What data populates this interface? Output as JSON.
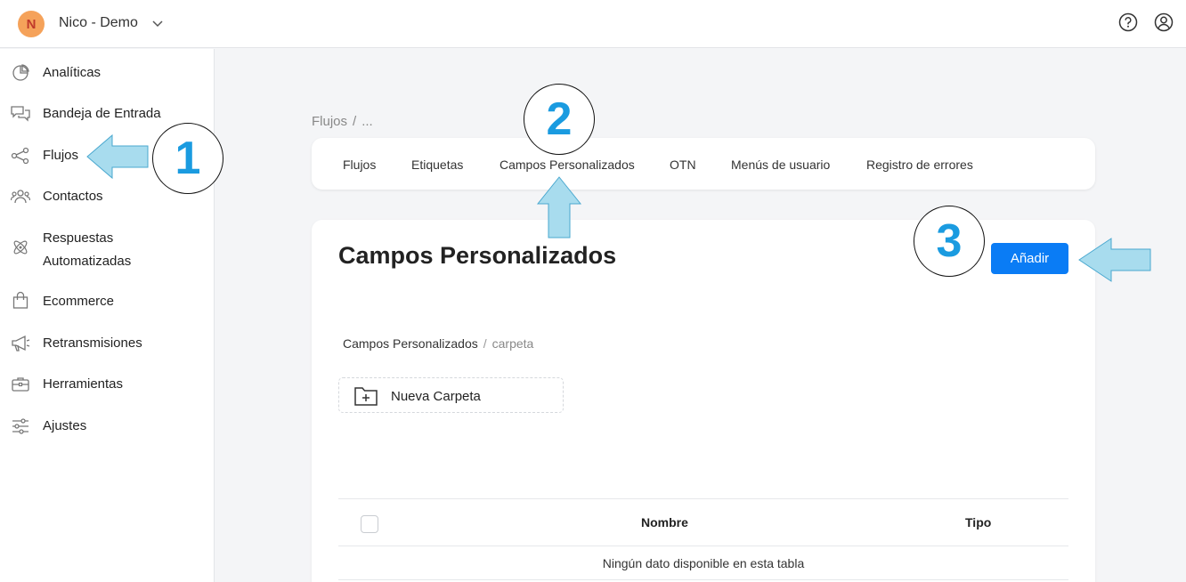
{
  "header": {
    "avatar_initial": "N",
    "workspace": "Nico - Demo"
  },
  "sidebar": {
    "items": [
      {
        "label": "Analíticas",
        "icon": "pie-chart-icon"
      },
      {
        "label": "Bandeja de Entrada",
        "icon": "chat-bubbles-icon"
      },
      {
        "label": "Flujos",
        "icon": "flow-nodes-icon"
      },
      {
        "label": "Contactos",
        "icon": "people-icon"
      },
      {
        "label": "Respuestas",
        "label2": "Automatizadas",
        "icon": "atom-icon"
      },
      {
        "label": "Ecommerce",
        "icon": "shopping-bag-icon"
      },
      {
        "label": "Retransmisiones",
        "icon": "megaphone-icon"
      },
      {
        "label": "Herramientas",
        "icon": "toolbox-icon"
      },
      {
        "label": "Ajustes",
        "icon": "sliders-icon"
      }
    ]
  },
  "breadcrumb": {
    "root": "Flujos",
    "sep": "/",
    "rest": "..."
  },
  "tabs": [
    {
      "label": "Flujos"
    },
    {
      "label": "Etiquetas"
    },
    {
      "label": "Campos Personalizados"
    },
    {
      "label": "OTN"
    },
    {
      "label": "Menús de usuario"
    },
    {
      "label": "Registro de errores"
    }
  ],
  "main": {
    "title": "Campos Personalizados",
    "add_label": "Añadir",
    "inner_crumbs": {
      "root": "Campos Personalizados",
      "sep": "/",
      "current": "carpeta"
    },
    "new_folder_label": "Nueva Carpeta",
    "table": {
      "columns": [
        "Nombre",
        "Tipo"
      ],
      "empty_text": "Ningún dato disponible en esta tabla"
    }
  },
  "annotations": [
    {
      "number": "1"
    },
    {
      "number": "2"
    },
    {
      "number": "3"
    }
  ],
  "colors": {
    "accent": "#0a7cf5",
    "annotation_arrow": "#a8dcee",
    "annotation_number": "#1a9be0",
    "avatar": "#f5a25a"
  }
}
